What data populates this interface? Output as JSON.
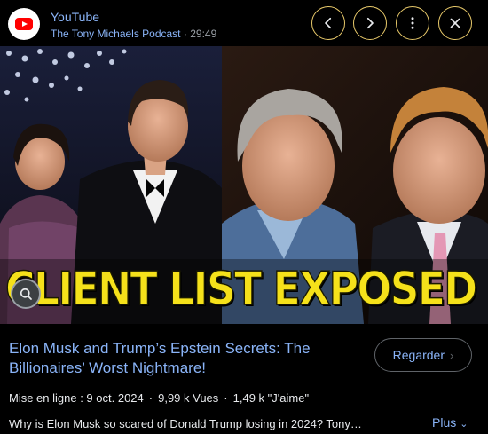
{
  "header": {
    "source": "YouTube",
    "channel": "The Tony Michaels Podcast",
    "separator": "·",
    "duration": "29:49",
    "buttons": [
      "chevron-left-icon",
      "chevron-right-icon",
      "more-vert-icon",
      "close-icon"
    ]
  },
  "thumbnail": {
    "banner_text": "CLIENT LIST EXPOSED",
    "banner_color": "#f5e11a"
  },
  "info": {
    "title": "Elon Musk and Trump’s Epstein Secrets: The Billionaires’ Worst Nightmare!",
    "watch_label": "Regarder",
    "meta": {
      "uploaded": "Mise en ligne : 9 oct. 2024",
      "views": "9,99 k Vues",
      "likes": "1,49 k \"J'aime\"",
      "separator": "·"
    },
    "description": "Why is Elon Musk so scared of Donald Trump losing in 2024? Tony…",
    "more_label": "Plus"
  },
  "colors": {
    "accent": "#8ab4f8",
    "button_ring": "#e8c96a",
    "background": "#000000"
  }
}
